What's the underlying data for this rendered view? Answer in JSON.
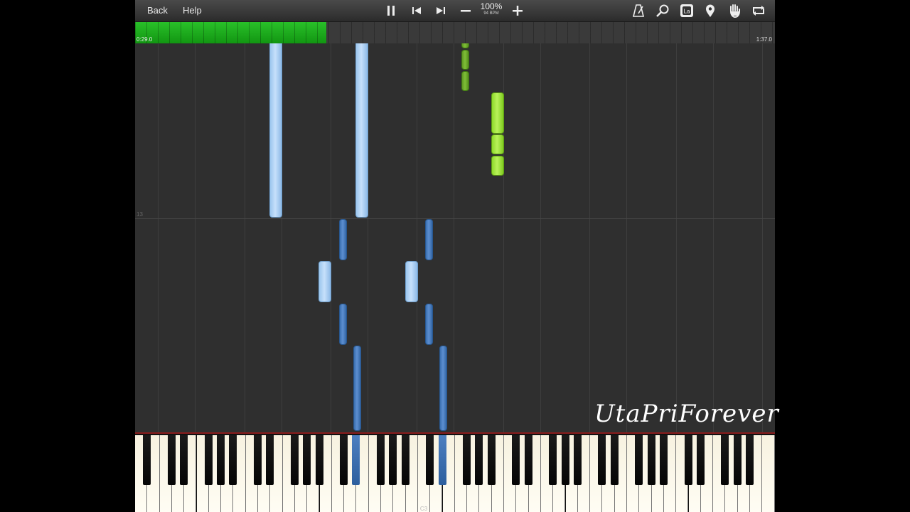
{
  "toolbar": {
    "back_label": "Back",
    "help_label": "Help",
    "speed_percent": "100%",
    "speed_bpm": "94 BPM",
    "icons": [
      "pause-icon",
      "previous-icon",
      "next-icon",
      "minus-icon",
      "plus-icon",
      "metronome-icon",
      "magnifier-icon",
      "note-label-icon",
      "location-pin-icon",
      "hand-icon",
      "loop-icon"
    ]
  },
  "progress": {
    "current": "0:29.0",
    "total": "1:37.0",
    "fraction": 0.299
  },
  "roll": {
    "measure_number": "13"
  },
  "keyboard": {
    "c_label": "C3"
  },
  "watermark": "UtaPriForever",
  "colors": {
    "light_blue_note": "#b4d6f6",
    "dark_blue_note": "#4a7fc2",
    "light_green_note": "#a8ea45",
    "dark_green_note": "#72b030",
    "progress_green": "#22b022"
  }
}
